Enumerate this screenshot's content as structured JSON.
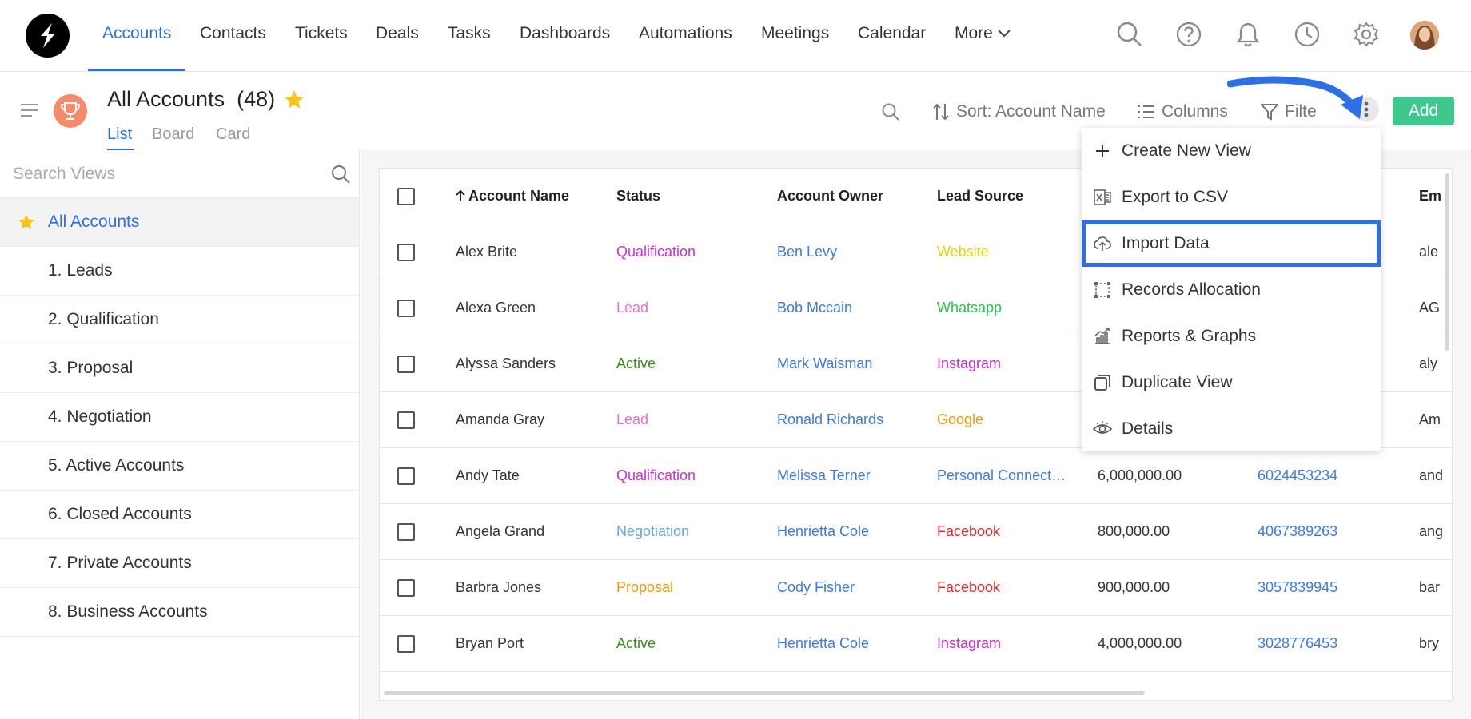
{
  "nav": {
    "items": [
      {
        "label": "Accounts",
        "active": true
      },
      {
        "label": "Contacts"
      },
      {
        "label": "Tickets"
      },
      {
        "label": "Deals"
      },
      {
        "label": "Tasks"
      },
      {
        "label": "Dashboards"
      },
      {
        "label": "Automations"
      },
      {
        "label": "Meetings"
      },
      {
        "label": "Calendar"
      }
    ],
    "more_label": "More",
    "icons": [
      "search-icon",
      "help-icon",
      "bell-icon",
      "clock-icon",
      "gear-icon",
      "avatar"
    ]
  },
  "header": {
    "title": "All Accounts",
    "count": "(48)",
    "view_tabs": [
      "List",
      "Board",
      "Card"
    ],
    "sort_label": "Sort: Account Name",
    "columns_label": "Columns",
    "filter_label": "Filte",
    "add_label": "Add"
  },
  "sidebar": {
    "search_placeholder": "Search Views",
    "items": [
      {
        "label": "All Accounts",
        "active": true,
        "starred": true
      },
      {
        "label": "1. Leads"
      },
      {
        "label": "2. Qualification"
      },
      {
        "label": "3. Proposal"
      },
      {
        "label": "4. Negotiation"
      },
      {
        "label": "5. Active Accounts"
      },
      {
        "label": "6. Closed Accounts"
      },
      {
        "label": "7. Private Accounts"
      },
      {
        "label": "8. Business Accounts"
      }
    ]
  },
  "table": {
    "columns": [
      "Account Name",
      "Status",
      "Account Owner",
      "Lead Source",
      "Em"
    ],
    "rows": [
      {
        "name": "Alex Brite",
        "status": "Qualification",
        "owner": "Ben Levy",
        "source": "Website",
        "revenue": "",
        "phone": "",
        "email": "ale"
      },
      {
        "name": "Alexa Green",
        "status": "Lead",
        "owner": "Bob Mccain",
        "source": "Whatsapp",
        "revenue": "",
        "phone": "",
        "email": "AG"
      },
      {
        "name": "Alyssa Sanders",
        "status": "Active",
        "owner": "Mark Waisman",
        "source": "Instagram",
        "revenue": "",
        "phone": "",
        "email": "aly"
      },
      {
        "name": "Amanda Gray",
        "status": "Lead",
        "owner": "Ronald Richards",
        "source": "Google",
        "revenue": "",
        "phone": "",
        "email": "Am"
      },
      {
        "name": "Andy Tate",
        "status": "Qualification",
        "owner": "Melissa Terner",
        "source": "Personal Connect…",
        "revenue": "6,000,000.00",
        "phone": "6024453234",
        "email": "and"
      },
      {
        "name": "Angela Grand",
        "status": "Negotiation",
        "owner": "Henrietta Cole",
        "source": "Facebook",
        "revenue": "800,000.00",
        "phone": "4067389263",
        "email": "ang"
      },
      {
        "name": "Barbra Jones",
        "status": "Proposal",
        "owner": "Cody Fisher",
        "source": "Facebook",
        "revenue": "900,000.00",
        "phone": "3057839945",
        "email": "bar"
      },
      {
        "name": "Bryan Port",
        "status": "Active",
        "owner": "Henrietta Cole",
        "source": "Instagram",
        "revenue": "4,000,000.00",
        "phone": "3028776453",
        "email": "bry"
      }
    ]
  },
  "status_colors": {
    "Qualification": "#cc2ed6",
    "Lead": "#ee6fc6",
    "Active": "#3b8a19",
    "Negotiation": "#6aa6e8",
    "Proposal": "#ef9a0f"
  },
  "source_colors": {
    "Website": "#e6d213",
    "Whatsapp": "#27c24c",
    "Instagram": "#c82bd3",
    "Google": "#ef9a0f",
    "Personal Connect…": "#3b7ae3",
    "Facebook": "#e0262e"
  },
  "menu": {
    "items": [
      {
        "label": "Create New View",
        "icon": "plus-icon"
      },
      {
        "label": "Export to CSV",
        "icon": "excel-icon"
      },
      {
        "label": "Import Data",
        "icon": "cloud-upload-icon",
        "highlighted": true
      },
      {
        "label": "Records Allocation",
        "icon": "allocation-icon"
      },
      {
        "label": "Reports & Graphs",
        "icon": "chart-icon"
      },
      {
        "label": "Duplicate View",
        "icon": "duplicate-icon"
      },
      {
        "label": "Details",
        "icon": "eye-icon"
      }
    ]
  },
  "colors": {
    "accent": "#2f6fe4",
    "add_button": "#3ec88e",
    "annotation_arrow": "#2f6fe4"
  }
}
